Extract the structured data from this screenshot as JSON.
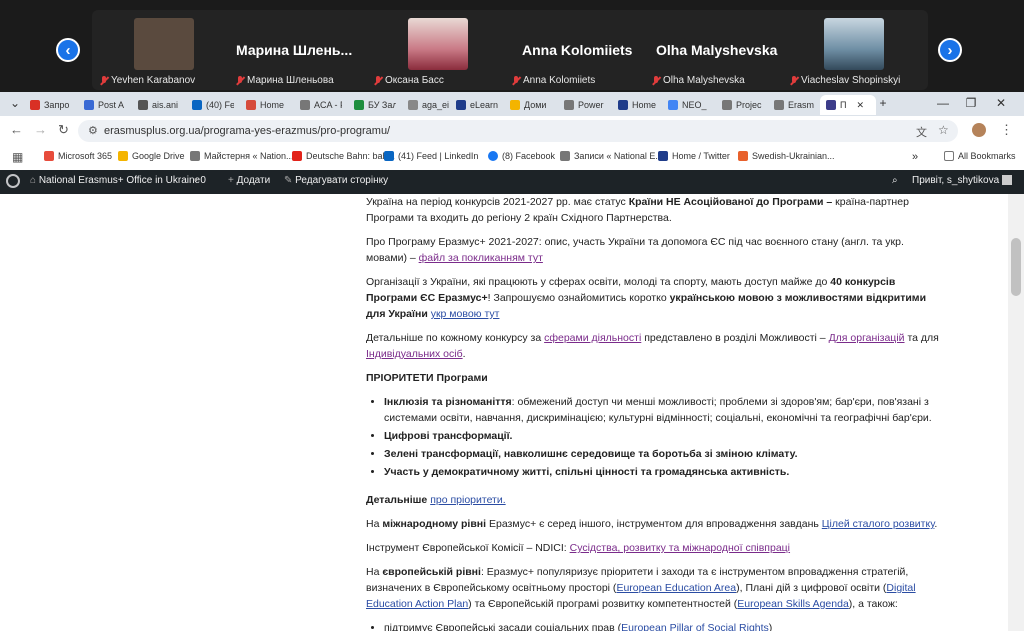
{
  "meeting": {
    "participants": [
      {
        "label": "Yevhen Karabanov",
        "avatar_color": "#5a4a3e"
      },
      {
        "label": "Марина Шленьова",
        "big_name": "Марина  Шлень..."
      },
      {
        "label": "Оксана Басс",
        "avatar_color": "#c97a86"
      },
      {
        "label": "Anna Kolomiiets",
        "big_name": "Anna Kolomiiets"
      },
      {
        "label": "Olha Malyshevska",
        "big_name": "Olha Malyshevska"
      },
      {
        "label": "Viacheslav Shopinskyi",
        "avatar_color": "#6f8fa5"
      }
    ],
    "prev_symbol": "‹",
    "next_symbol": "›"
  },
  "browser": {
    "tabs": [
      {
        "label": "Запро",
        "color": "#d93025"
      },
      {
        "label": "Post A",
        "color": "#3a6ad4"
      },
      {
        "label": "ais.ani",
        "color": "#555"
      },
      {
        "label": "(40) Fe",
        "color": "#0a66c2"
      },
      {
        "label": "Home",
        "color": "#d64b3b"
      },
      {
        "label": "ACA - F",
        "color": "#777"
      },
      {
        "label": "БУ Зал",
        "color": "#1e8e3e"
      },
      {
        "label": "aga_ei",
        "color": "#888"
      },
      {
        "label": "eLearn",
        "color": "#1f3c8a"
      },
      {
        "label": "Доми",
        "color": "#f4b400"
      },
      {
        "label": "Power",
        "color": "#777"
      },
      {
        "label": "Home",
        "color": "#1f3c8a"
      },
      {
        "label": "NEO_",
        "color": "#4285f4"
      },
      {
        "label": "Projec",
        "color": "#777"
      },
      {
        "label": "Erasm",
        "color": "#777"
      },
      {
        "label": "П",
        "color": "#3c3c8a"
      }
    ],
    "new_tab": "+",
    "window_controls": {
      "minimize": "—",
      "maximize": "❐",
      "close": "✕"
    },
    "url": "erasmusplus.org.ua/programa-yes-erazmus/pro-programu/",
    "bookmarks": [
      {
        "label": "Microsoft 365",
        "color": "#e74c3c"
      },
      {
        "label": "Google Drive",
        "color": "#f4b400"
      },
      {
        "label": "Майстерня « Nation...",
        "color": "#777"
      },
      {
        "label": "Deutsche Bahn: bah...",
        "color": "#e2231a"
      },
      {
        "label": "(41) Feed | LinkedIn",
        "color": "#0a66c2"
      },
      {
        "label": "(8) Facebook",
        "color": "#1877f2"
      },
      {
        "label": "Записи « National E...",
        "color": "#777"
      },
      {
        "label": "Home / Twitter",
        "color": "#1f3c8a"
      },
      {
        "label": "Swedish-Ukrainian...",
        "color": "#e8612c"
      }
    ],
    "more_bookmarks": "»",
    "all_bookmarks": "All Bookmarks"
  },
  "wp_admin": {
    "site_name": "National Erasmus+ Office in Ukraine",
    "comments": "0",
    "add_new": "Додати",
    "edit_page": "Редагувати сторінку",
    "greeting": "Привіт, s_shytikova"
  },
  "content": {
    "p1_text": "Україна на період конкурсів 2021-2027 рр. має статус ",
    "p1_bold": "Країни НЕ Асоційованої до Програми –",
    "p1_rest": " країна-партнер Програми та входить до регіону 2 країн Східного Партнерства.",
    "p2_text": "Про Програму Еразмус+ 2021-2027: опис, участь України та допомога ЄС під час воєнного стану (англ. та укр. мовами) – ",
    "p2_link": "файл за покликанням тут",
    "p3_text": "Організації з України, які працюють у сферах освіти, молоді та спорту, мають доступ майже до ",
    "p3_bold": "40 конкурсів Програми ЄС Еразмус+",
    "p3_mid": "! Запрошуємо ознайомитись коротко ",
    "p3_bold2": "українською мовою з можливостями відкритими для України",
    "p3_link": "укр мовою тут",
    "p4_text": "Детальніше по кожному конкурсу за ",
    "p4_link1": "сферами діяльності",
    "p4_mid": " представлено в розділі Можливості – ",
    "p4_link2": "Для організацій",
    "p4_and": " та для ",
    "p4_link3": "Індивідуальних осіб",
    "p4_end": ".",
    "priorities_heading": "ПРІОРИТЕТИ Програми",
    "pr1_bold": "Інклюзія та різноманіття",
    "pr1_rest": ": обмежений доступ чи менші можливості; проблеми зі здоров'ям; бар'єри, пов'язані з системами освіти, навчання, дискримінацією; культурні відмінності; соціальні, економічні та географічні бар'єри.",
    "pr2": "Цифрові трансформації.",
    "pr3": "Зелені трансформації, навколишнє середовище та боротьба зі зміною клімату.",
    "pr4": "Участь у демократичному житті, спільні цінності та громадянська активність.",
    "more_bold": "Детальніше ",
    "more_link": "про пріоритети.",
    "intl_pre": "На ",
    "intl_bold": "міжнародному рівні",
    "intl_rest": " Еразмус+ є серед іншого, інструментом для впровадження завдань ",
    "intl_link": "Цілей сталого розвитку",
    "intl_end": ".",
    "ndici_text": "Інструмент Європейської Комісії – NDICI: ",
    "ndici_link": "Сусідства, розвитку та міжнародної співпраці",
    "eu_pre": "На ",
    "eu_bold": "європейській рівні",
    "eu_rest1": ": Еразмус+ популяризує пріоритети і заходи та є інструментом впровадження стратегій, визначених в Європейському освітньому просторі (",
    "eu_link1": "European Education Area",
    "eu_rest2": "), Плані дій з цифрової освіти (",
    "eu_link2": "Digital Education Action Plan",
    "eu_rest3": ") та Європейській програмі розвитку компетентностей (",
    "eu_link3": "European Skills Agenda",
    "eu_rest4": "), а також:",
    "last_bullet_text": "підтримує Європейські засади соціальних прав (",
    "last_bullet_link": "European Pillar of Social Rights",
    "last_bullet_end": ")"
  }
}
